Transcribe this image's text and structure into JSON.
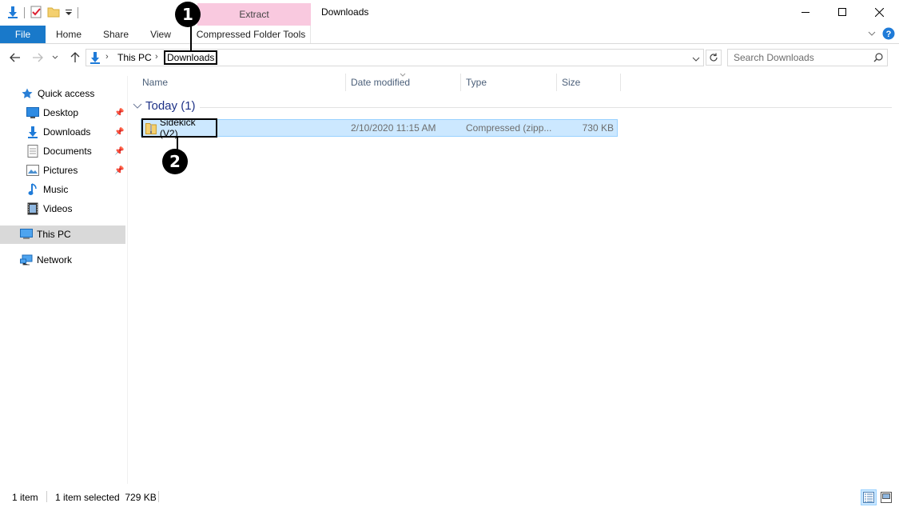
{
  "window": {
    "title": "Downloads",
    "context_tab": "Extract",
    "minimize_glyph": "—",
    "maximize_glyph": "☐",
    "close_glyph": "✕"
  },
  "ribbon": {
    "tabs": [
      "File",
      "Home",
      "Share",
      "View",
      "Compressed Folder Tools"
    ]
  },
  "address": {
    "crumbs": [
      "This PC",
      "Downloads"
    ],
    "search_placeholder": "Search Downloads"
  },
  "sidebar": {
    "quick_access": "Quick access",
    "items": [
      "Desktop",
      "Downloads",
      "Documents",
      "Pictures",
      "Music",
      "Videos"
    ],
    "this_pc": "This PC",
    "network": "Network"
  },
  "columns": [
    "Name",
    "Date modified",
    "Type",
    "Size"
  ],
  "group": {
    "label": "Today (1)"
  },
  "file": {
    "name": "Sidekick (V2)",
    "date": "2/10/2020 11:15 AM",
    "type": "Compressed (zipp...",
    "size": "730 KB"
  },
  "callouts": [
    "1",
    "2"
  ],
  "status": {
    "count": "1 item",
    "selected": "1 item selected  729 KB"
  },
  "colors": {
    "file_tab": "#1979ca",
    "context_tab": "#f9c9df",
    "selection": "#cce8ff",
    "group_text": "#1e3287"
  }
}
